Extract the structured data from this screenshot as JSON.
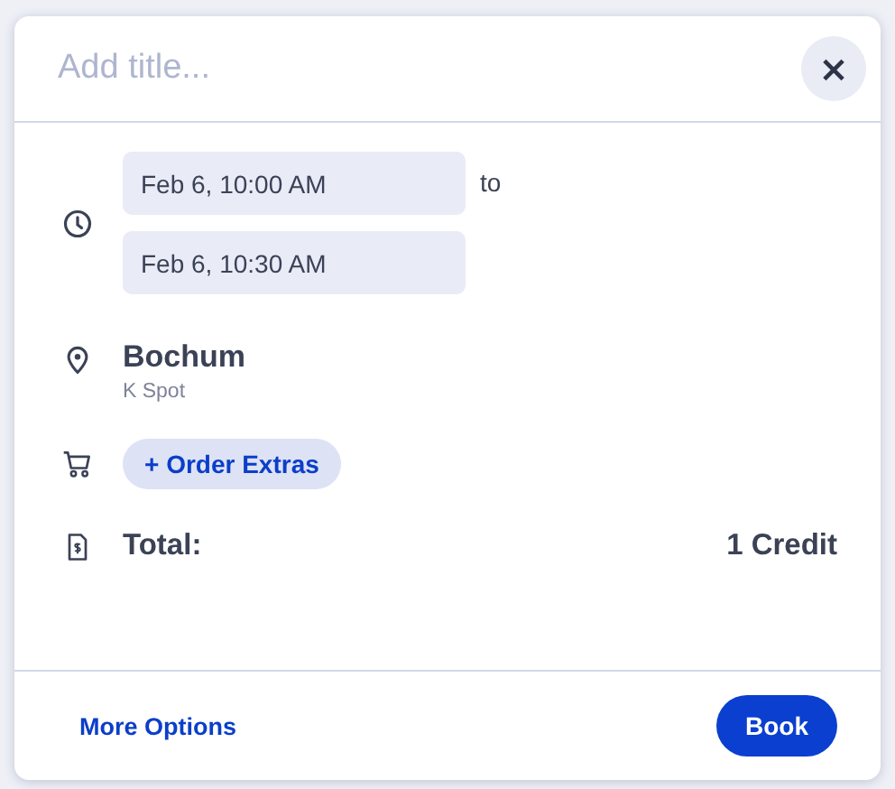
{
  "dialog": {
    "title": {
      "placeholder": "Add title..."
    },
    "close": "×",
    "time": {
      "start": "Feb 6, 10:00 AM",
      "separator": "to",
      "end": "Feb 6, 10:30 AM"
    },
    "location": {
      "name": "Bochum",
      "detail": "K Spot"
    },
    "extras": {
      "label": "+ Order Extras"
    },
    "total": {
      "label": "Total:",
      "value": "1 Credit"
    },
    "footer": {
      "link": "More Options",
      "button": "Book"
    }
  }
}
